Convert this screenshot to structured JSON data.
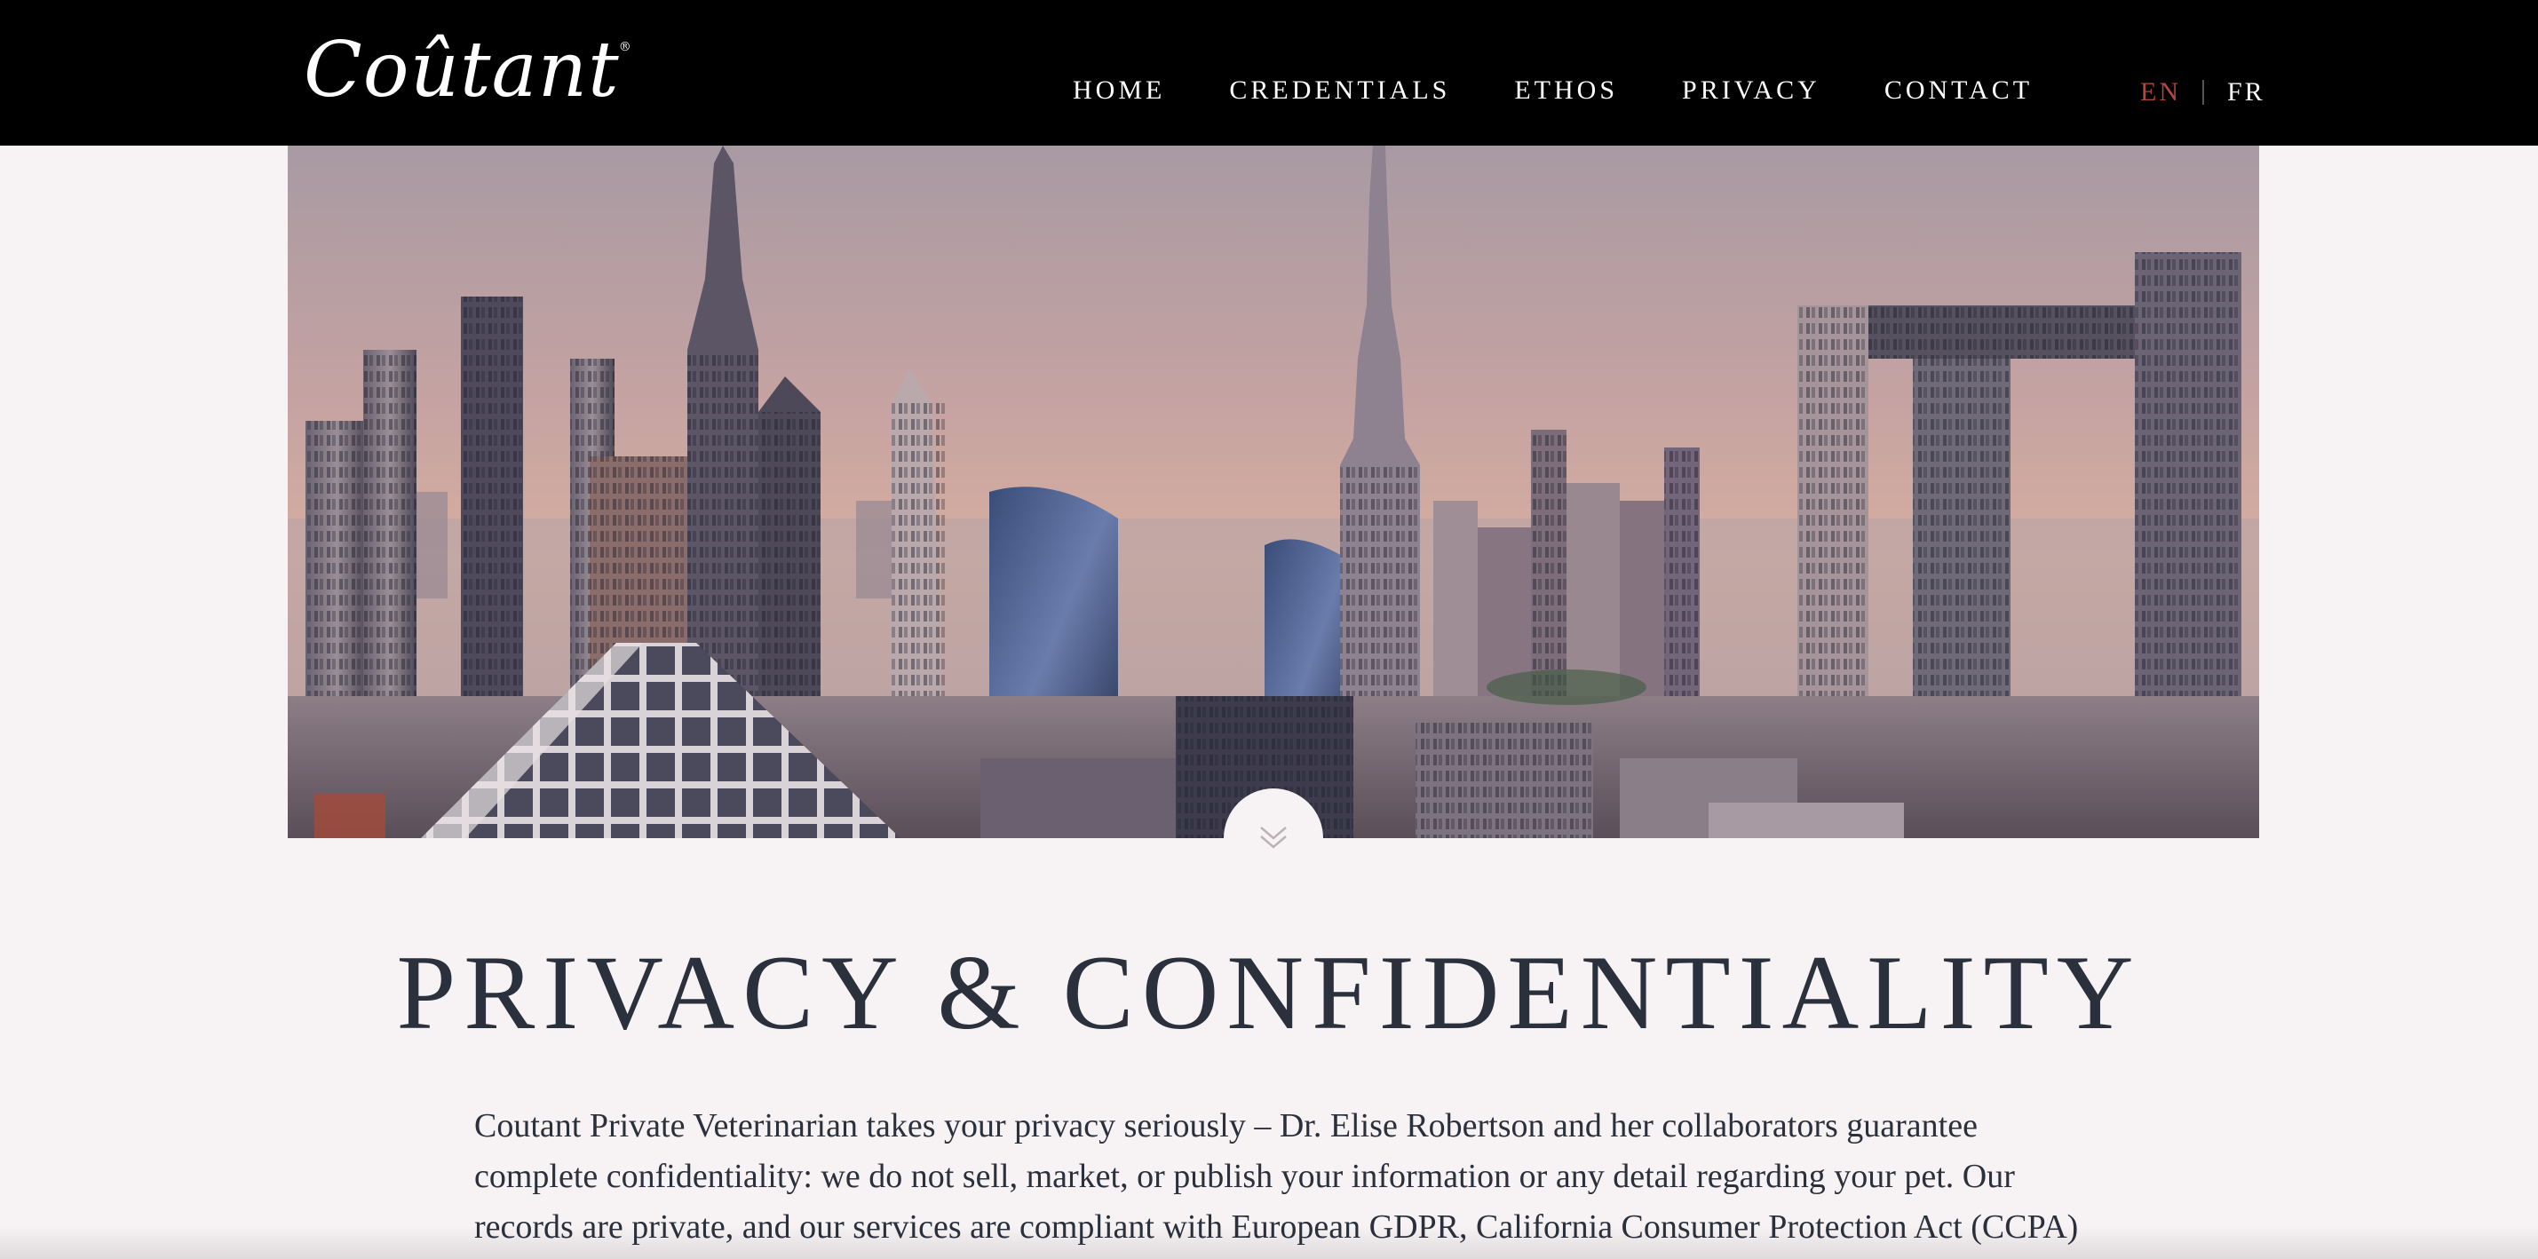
{
  "brand": {
    "logo_text": "Coûtant",
    "registered_mark": "®"
  },
  "nav": {
    "items": [
      {
        "label": "HOME"
      },
      {
        "label": "CREDENTIALS"
      },
      {
        "label": "ETHOS"
      },
      {
        "label": "PRIVACY"
      },
      {
        "label": "CONTACT"
      }
    ]
  },
  "language": {
    "options": [
      {
        "code": "EN",
        "active": true
      },
      {
        "code": "FR",
        "active": false
      }
    ],
    "active_color": "#b4473d"
  },
  "hero": {
    "image": "dubai-skyline-sunset",
    "scroll_icon": "double-chevron-down-icon"
  },
  "page": {
    "title": "PRIVACY & CONFIDENTIALITY",
    "paragraph": "Coutant Private Veterinarian takes your privacy seriously – Dr. Elise Robertson and her collaborators guarantee complete confidentiality: we do not sell, market, or publish your information or any detail regarding your pet. Our records are private, and our services are compliant with European GDPR, California Consumer Protection Act (CCPA) and the"
  },
  "colors": {
    "header_bg": "#000000",
    "page_bg": "#f7f3f4",
    "text": "#2b313c"
  }
}
